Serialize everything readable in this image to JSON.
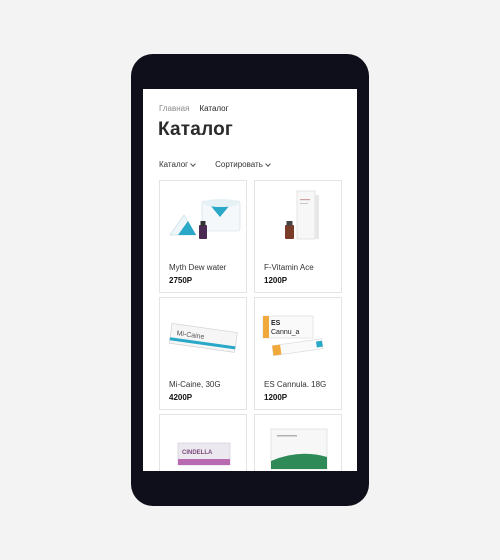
{
  "breadcrumb": {
    "home": "Главная",
    "current": "Каталог"
  },
  "page_title": "Каталог",
  "filters": {
    "catalog": "Каталог",
    "sort": "Сортировать"
  },
  "products": [
    {
      "name": "Myth Dew water",
      "price": "2750Р",
      "image": "myth-dew-box-and-vial"
    },
    {
      "name": "F-Vitamin Ace",
      "price": "1200Р",
      "image": "f-vitamin-box-and-vial"
    },
    {
      "name": "Mi-Caine, 30G",
      "price": "4200Р",
      "image": "mi-caine-tube"
    },
    {
      "name": "ES Cannula. 18G",
      "price": "1200Р",
      "image": "es-cannula-box"
    },
    {
      "name": "",
      "price": "",
      "image": "purple-box"
    },
    {
      "name": "",
      "price": "",
      "image": "green-box"
    }
  ],
  "image_labels": {
    "mi_caine": "Mi-Caine",
    "es_cannula_brand": "ES",
    "es_cannula_word": "Cannu_a",
    "cindella": "CINDELLA"
  },
  "colors": {
    "device": "#0e0f1a",
    "background": "#f3f3f3",
    "accent_blue": "#2aa8c8",
    "accent_orange": "#f2a93b"
  }
}
